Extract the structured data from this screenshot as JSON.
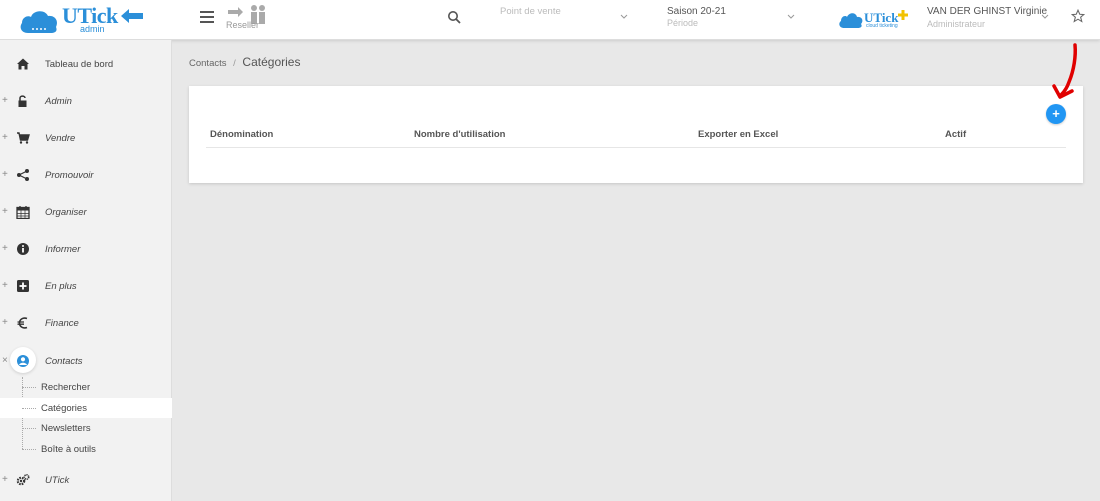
{
  "header": {
    "logo_text": "UTick",
    "logo_sub": "admin",
    "reseller_label": "Reseller",
    "point_de_vente": {
      "value": "Point de vente"
    },
    "season": {
      "value": "Saison 20-21",
      "sub": "Période"
    },
    "brand2_text": "UTick",
    "brand2_sub": "cloud ticketing",
    "user": {
      "name": "VAN DER GHINST Virginie",
      "role": "Administrateur"
    }
  },
  "sidebar": {
    "items": [
      {
        "label": "Tableau de bord",
        "icon": "home-icon"
      },
      {
        "label": "Admin",
        "icon": "lock-icon"
      },
      {
        "label": "Vendre",
        "icon": "cart-icon"
      },
      {
        "label": "Promouvoir",
        "icon": "share-icon"
      },
      {
        "label": "Organiser",
        "icon": "calendar-icon"
      },
      {
        "label": "Informer",
        "icon": "info-icon"
      },
      {
        "label": "En plus",
        "icon": "plus-square-icon"
      },
      {
        "label": "Finance",
        "icon": "euro-icon"
      },
      {
        "label": "Contacts",
        "icon": "user-circle-icon"
      },
      {
        "label": "UTick",
        "icon": "gears-icon"
      }
    ],
    "contacts_sub": [
      {
        "label": "Rechercher"
      },
      {
        "label": "Catégories"
      },
      {
        "label": "Newsletters"
      },
      {
        "label": "Boîte à outils"
      }
    ],
    "expand_symbol": "+",
    "collapse_symbol": "×"
  },
  "breadcrumb": {
    "parent": "Contacts",
    "sep": "/",
    "current": "Catégories"
  },
  "table": {
    "add_label": "+",
    "columns": [
      "Dénomination",
      "Nombre d'utilisation",
      "Exporter en Excel",
      "Actif"
    ]
  },
  "colors": {
    "accent": "#2196f3",
    "brand": "#2b8fd9",
    "annotation": "#e00000"
  }
}
